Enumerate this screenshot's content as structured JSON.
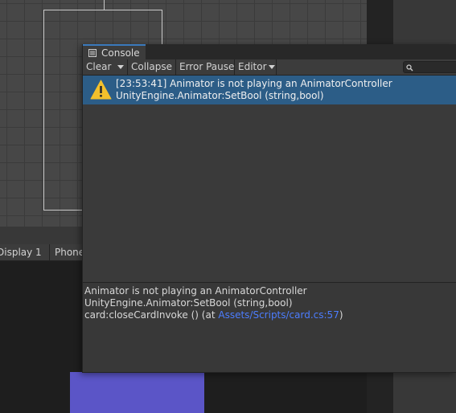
{
  "scene": {},
  "game_view": {
    "display_label": "Display 1",
    "aspect_label": "Phone"
  },
  "console": {
    "tab_label": "Console",
    "toolbar": {
      "clear_label": "Clear",
      "collapse_label": "Collapse",
      "error_pause_label": "Error Pause",
      "editor_label": "Editor"
    },
    "search": {
      "value": ""
    },
    "log_entries": [
      {
        "line1": "[23:53:41] Animator is not playing an AnimatorController",
        "line2": "UnityEngine.Animator:SetBool (string,bool)",
        "icon": "warning-icon"
      }
    ],
    "detail": {
      "line1": "Animator is not playing an AnimatorController",
      "line2": "UnityEngine.Animator:SetBool (string,bool)",
      "line3_prefix": "card:closeCardInvoke () (at ",
      "line3_link": "Assets/Scripts/card.cs:57",
      "line3_suffix": ")"
    }
  },
  "colors": {
    "accent_tab": "#3a79bb",
    "selected_row": "#2c5d87",
    "link": "#4c7dff",
    "warning": "#f3c02c",
    "game_canvas": "#5b55c7"
  }
}
